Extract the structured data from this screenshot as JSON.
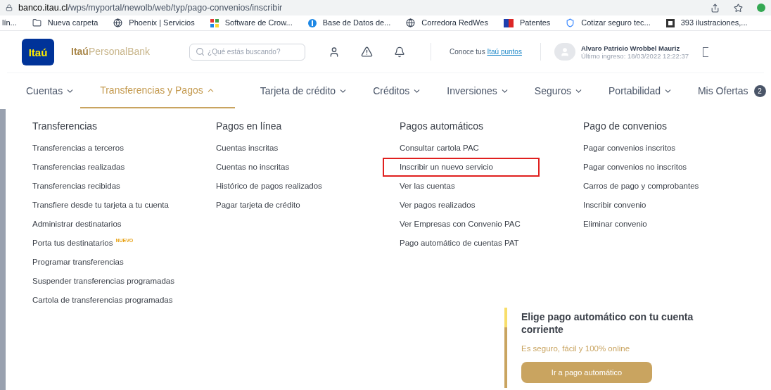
{
  "browser": {
    "url_host": "banco.itau.cl",
    "url_path": "/wps/myportal/newolb/web/typ/pago-convenios/inscribir",
    "bookmarks": [
      {
        "label": "lín...",
        "kind": "none"
      },
      {
        "label": "Nueva carpeta",
        "kind": "folder"
      },
      {
        "label": "Phoenix | Servicios",
        "kind": "globe"
      },
      {
        "label": "Software de Crow...",
        "kind": "tiles"
      },
      {
        "label": "Base de Datos de...",
        "kind": "circle"
      },
      {
        "label": "Corredora RedWes",
        "kind": "globe"
      },
      {
        "label": "Patentes",
        "kind": "flag"
      },
      {
        "label": "Cotizar seguro tec...",
        "kind": "shield"
      },
      {
        "label": "393 ilustraciones,...",
        "kind": "square"
      }
    ]
  },
  "header": {
    "logo": "Itaú",
    "brand_bold": "Itaú",
    "brand_rest": "PersonalBank",
    "search_placeholder": "¿Qué estás buscando?",
    "points_prefix": "Conoce tus",
    "points_link": "Itaú puntos",
    "user_name": "Alvaro Patricio Wrobbel Mauriz",
    "last_login": "Último ingreso: 18/03/2022 12:22:37"
  },
  "nav": [
    {
      "label": "Cuentas",
      "selected": false,
      "expanded": false
    },
    {
      "label": "Transferencias y Pagos",
      "selected": true,
      "expanded": true
    },
    {
      "label": "Tarjeta de crédito",
      "selected": false,
      "expanded": false
    },
    {
      "label": "Créditos",
      "selected": false,
      "expanded": false
    },
    {
      "label": "Inversiones",
      "selected": false,
      "expanded": false
    },
    {
      "label": "Seguros",
      "selected": false,
      "expanded": false
    },
    {
      "label": "Portabilidad",
      "selected": false,
      "expanded": false
    }
  ],
  "offers": {
    "label": "Mis Ofertas",
    "count": "2"
  },
  "menu": [
    {
      "title": "Transferencias",
      "items": [
        {
          "label": "Transferencias a terceros",
          "highlighted": false
        },
        {
          "label": "Transferencias realizadas",
          "highlighted": false
        },
        {
          "label": "Transferencias recibidas",
          "highlighted": false
        },
        {
          "label": "Transfiere desde tu tarjeta a tu cuenta",
          "highlighted": false
        },
        {
          "label": "Administrar destinatarios",
          "highlighted": false
        },
        {
          "label": "Porta tus destinatarios",
          "badge": "NUEVO",
          "highlighted": false
        },
        {
          "label": "Programar transferencias",
          "highlighted": false
        },
        {
          "label": "Suspender transferencias programadas",
          "highlighted": false
        },
        {
          "label": "Cartola de transferencias programadas",
          "highlighted": false
        }
      ]
    },
    {
      "title": "Pagos en línea",
      "items": [
        {
          "label": "Cuentas inscritas",
          "highlighted": false
        },
        {
          "label": "Cuentas no inscritas",
          "highlighted": false
        },
        {
          "label": "Histórico de pagos realizados",
          "highlighted": false
        },
        {
          "label": "Pagar tarjeta de crédito",
          "highlighted": false
        }
      ]
    },
    {
      "title": "Pagos automáticos",
      "items": [
        {
          "label": "Consultar cartola PAC",
          "highlighted": false
        },
        {
          "label": "Inscribir un nuevo servicio",
          "highlighted": true
        },
        {
          "label": "Ver las cuentas",
          "highlighted": false
        },
        {
          "label": "Ver pagos realizados",
          "highlighted": false
        },
        {
          "label": "Ver Empresas con Convenio PAC",
          "highlighted": false
        },
        {
          "label": "Pago automático de cuentas PAT",
          "highlighted": false
        }
      ]
    },
    {
      "title": "Pago de convenios",
      "items": [
        {
          "label": "Pagar convenios inscritos",
          "highlighted": false
        },
        {
          "label": "Pagar convenios no inscritos",
          "highlighted": false
        },
        {
          "label": "Carros de pago y comprobantes",
          "highlighted": false
        },
        {
          "label": "Inscribir convenio",
          "highlighted": false
        },
        {
          "label": "Eliminar convenio",
          "highlighted": false
        }
      ]
    }
  ],
  "promo": {
    "title": "Elige pago automático con tu cuenta corriente",
    "subtitle": "Es seguro, fácil y 100% online",
    "button": "Ir a pago automático"
  }
}
